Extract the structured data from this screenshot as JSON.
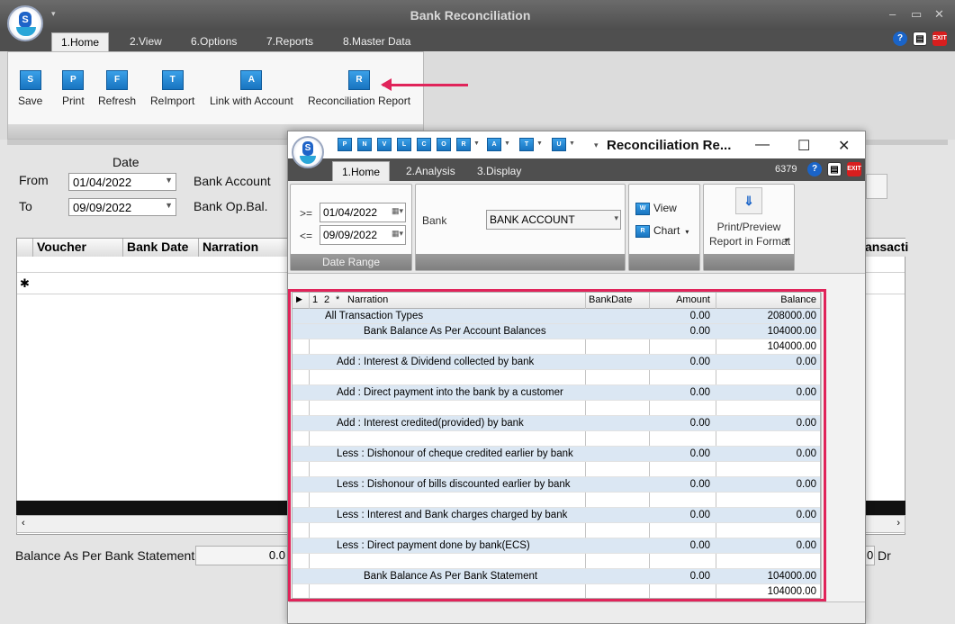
{
  "main": {
    "title": "Bank Reconciliation",
    "tabs": [
      "1.Home",
      "2.View",
      "6.Options",
      "7.Reports",
      "8.Master Data"
    ],
    "ribbon_buttons": [
      {
        "label": "Save",
        "glyph": "S"
      },
      {
        "label": "Print",
        "glyph": "P"
      },
      {
        "label": "Refresh",
        "glyph": "F"
      },
      {
        "label": "ReImport",
        "glyph": "T"
      },
      {
        "label": "Link with Account",
        "glyph": "A"
      },
      {
        "label": "Reconciliation Report",
        "glyph": "R"
      }
    ],
    "date_header": "Date",
    "from_label": "From",
    "from_value": "01/04/2022",
    "to_label": "To",
    "to_value": "09/09/2022",
    "bank_account_label": "Bank Account",
    "bank_opbal_label": "Bank Op.Bal.",
    "grid_columns": [
      "Voucher",
      "Bank Date",
      "Narration"
    ],
    "grid_partial_column": "ansacti",
    "new_row_marker": "✱",
    "balance_label": "Balance As Per Bank Statement",
    "balance_value": "0.0",
    "right_field_value": "0",
    "dr_label": "Dr",
    "window_controls": [
      "–",
      "▭",
      "✕"
    ]
  },
  "report": {
    "title": "Reconciliation Re...",
    "quick_icons": [
      "P",
      "N",
      "V",
      "L",
      "C",
      "O",
      "R",
      "A",
      "T",
      "U"
    ],
    "tabs": [
      "1.Home",
      "2.Analysis",
      "3.Display"
    ],
    "code": "6379",
    "ge_label": ">=",
    "from_date": "01/04/2022",
    "le_label": "<=",
    "to_date": "09/09/2022",
    "date_range_label": "Date Range",
    "bank_label": "Bank",
    "bank_value": "BANK ACCOUNT",
    "view_label": "View",
    "chart_label": "Chart",
    "print_preview_label": "Print/Preview",
    "report_format_label": "Report in Format",
    "columns": {
      "level1": "1",
      "level2": "2",
      "star": "*",
      "narration": "Narration",
      "bankdate": "BankDate",
      "amount": "Amount",
      "balance": "Balance"
    },
    "rows": [
      {
        "narration": "All Transaction Types",
        "amount": "0.00",
        "balance": "208000.00",
        "indent": 0
      },
      {
        "narration": "Bank Balance As Per Account Balances",
        "amount": "0.00",
        "balance": "104000.00",
        "indent": 2
      },
      {
        "narration": "",
        "amount": "",
        "balance": "104000.00",
        "indent": 0
      },
      {
        "narration": "Add  : Interest & Dividend collected by bank",
        "amount": "0.00",
        "balance": "0.00",
        "indent": 1
      },
      {
        "narration": "",
        "amount": "",
        "balance": "",
        "indent": 0
      },
      {
        "narration": "Add  : Direct payment into the bank by a customer",
        "amount": "0.00",
        "balance": "0.00",
        "indent": 1
      },
      {
        "narration": "",
        "amount": "",
        "balance": "",
        "indent": 0
      },
      {
        "narration": "Add  : Interest credited(provided) by bank",
        "amount": "0.00",
        "balance": "0.00",
        "indent": 1
      },
      {
        "narration": "",
        "amount": "",
        "balance": "",
        "indent": 0
      },
      {
        "narration": "Less : Dishonour of cheque credited earlier by bank",
        "amount": "0.00",
        "balance": "0.00",
        "indent": 1
      },
      {
        "narration": "",
        "amount": "",
        "balance": "",
        "indent": 0
      },
      {
        "narration": "Less : Dishonour of bills discounted earlier by bank",
        "amount": "0.00",
        "balance": "0.00",
        "indent": 1
      },
      {
        "narration": "",
        "amount": "",
        "balance": "",
        "indent": 0
      },
      {
        "narration": "Less : Interest and Bank charges charged by bank",
        "amount": "0.00",
        "balance": "0.00",
        "indent": 1
      },
      {
        "narration": "",
        "amount": "",
        "balance": "",
        "indent": 0
      },
      {
        "narration": "Less : Direct payment done by bank(ECS)",
        "amount": "0.00",
        "balance": "0.00",
        "indent": 1
      },
      {
        "narration": "",
        "amount": "",
        "balance": "",
        "indent": 0
      },
      {
        "narration": "Bank Balance As Per Bank Statement",
        "amount": "0.00",
        "balance": "104000.00",
        "indent": 2
      },
      {
        "narration": "",
        "amount": "",
        "balance": "104000.00",
        "indent": 0
      }
    ],
    "window_controls": [
      "—",
      "☐",
      "✕"
    ]
  },
  "colors": {
    "highlight": "#e0245a",
    "titlebar": "#4f4f4f",
    "row_alt": "#dbe7f3",
    "icon_blue": "#1874c0"
  }
}
